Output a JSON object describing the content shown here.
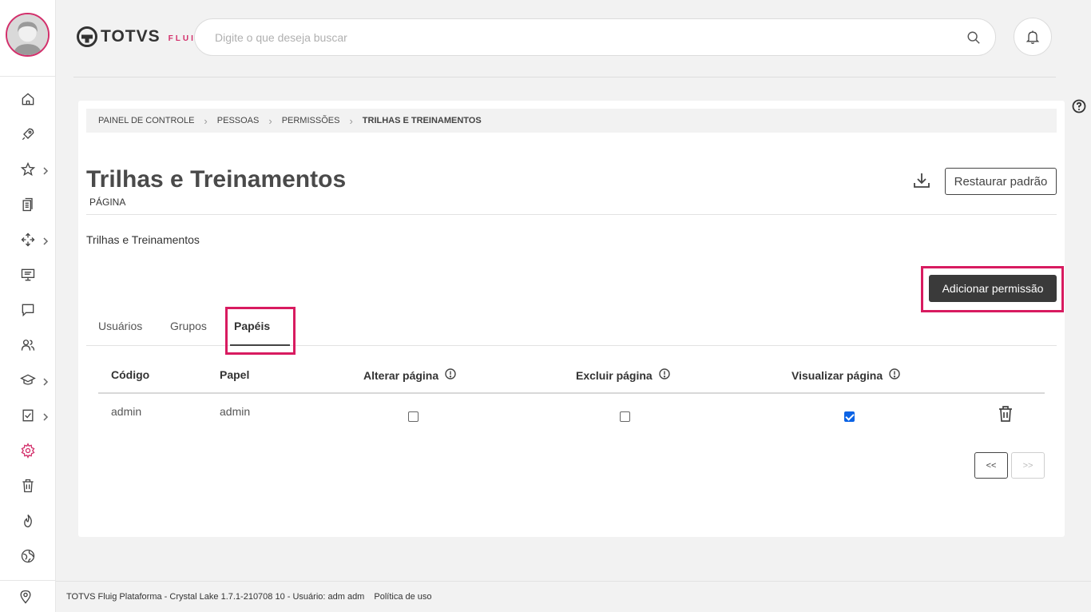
{
  "app": {
    "brand": "TOTVS",
    "brand_sub": "FLUIG",
    "accent_color": "#d32f6b"
  },
  "header": {
    "search_placeholder": "Digite o que deseja buscar"
  },
  "sidebar": {
    "items": [
      {
        "icon": "home-icon"
      },
      {
        "icon": "rocket-icon"
      },
      {
        "icon": "star-icon",
        "expandable": true
      },
      {
        "icon": "documents-icon"
      },
      {
        "icon": "workflow-icon",
        "expandable": true
      },
      {
        "icon": "presentation-icon"
      },
      {
        "icon": "chat-icon"
      },
      {
        "icon": "people-icon"
      },
      {
        "icon": "graduation-cap-icon",
        "expandable": true
      },
      {
        "icon": "tasks-icon",
        "expandable": true
      },
      {
        "icon": "gear-icon",
        "active": true
      },
      {
        "icon": "trash-icon"
      },
      {
        "icon": "fire-icon"
      },
      {
        "icon": "globe-icon"
      }
    ],
    "bottom_icon": "location-pin-icon"
  },
  "breadcrumb": {
    "items": [
      "PAINEL DE CONTROLE",
      "PESSOAS",
      "PERMISSÕES"
    ],
    "current": "TRILHAS E TREINAMENTOS"
  },
  "page": {
    "title": "Trilhas e Treinamentos",
    "subtitle": "PÁGINA",
    "description": "Trilhas e Treinamentos",
    "restore_label": "Restaurar padrão",
    "add_permission_label": "Adicionar permissão"
  },
  "tabs": [
    {
      "label": "Usuários"
    },
    {
      "label": "Grupos"
    },
    {
      "label": "Papéis",
      "active": true
    }
  ],
  "table": {
    "columns": [
      "Código",
      "Papel",
      "Alterar página",
      "Excluir página",
      "Visualizar página"
    ],
    "rows": [
      {
        "codigo": "admin",
        "papel": "admin",
        "alterar": false,
        "excluir": false,
        "visualizar": true
      }
    ]
  },
  "pager": {
    "prev_label": "<<",
    "next_label": ">>"
  },
  "footer": {
    "version_text": "TOTVS Fluig Plataforma - Crystal Lake 1.7.1-210708 10 - Usuário: adm adm",
    "policy_link": "Política de uso"
  }
}
